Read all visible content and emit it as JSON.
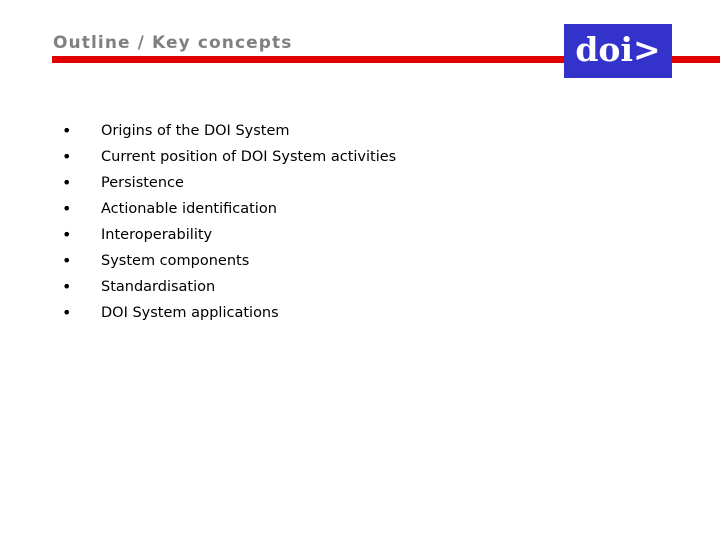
{
  "slide": {
    "background_color": "#ffffff",
    "accent_rule_color": "#e00000",
    "title_color": "#808080",
    "body_text_color": "#000000"
  },
  "header": {
    "title": "Outline / Key concepts",
    "rule": {
      "name": "horizontal-rule",
      "color": "#e00000"
    }
  },
  "logo": {
    "text": "doi>",
    "background_color": "#3333cc",
    "text_color": "#ffffff"
  },
  "main": {
    "bullet_glyph": "•",
    "items": [
      {
        "label": "Origins of the DOI System"
      },
      {
        "label": "Current position of DOI System activities"
      },
      {
        "label": "Persistence"
      },
      {
        "label": "Actionable identification"
      },
      {
        "label": "Interoperability"
      },
      {
        "label": "System components"
      },
      {
        "label": "Standardisation"
      },
      {
        "label": "DOI System applications"
      }
    ]
  }
}
